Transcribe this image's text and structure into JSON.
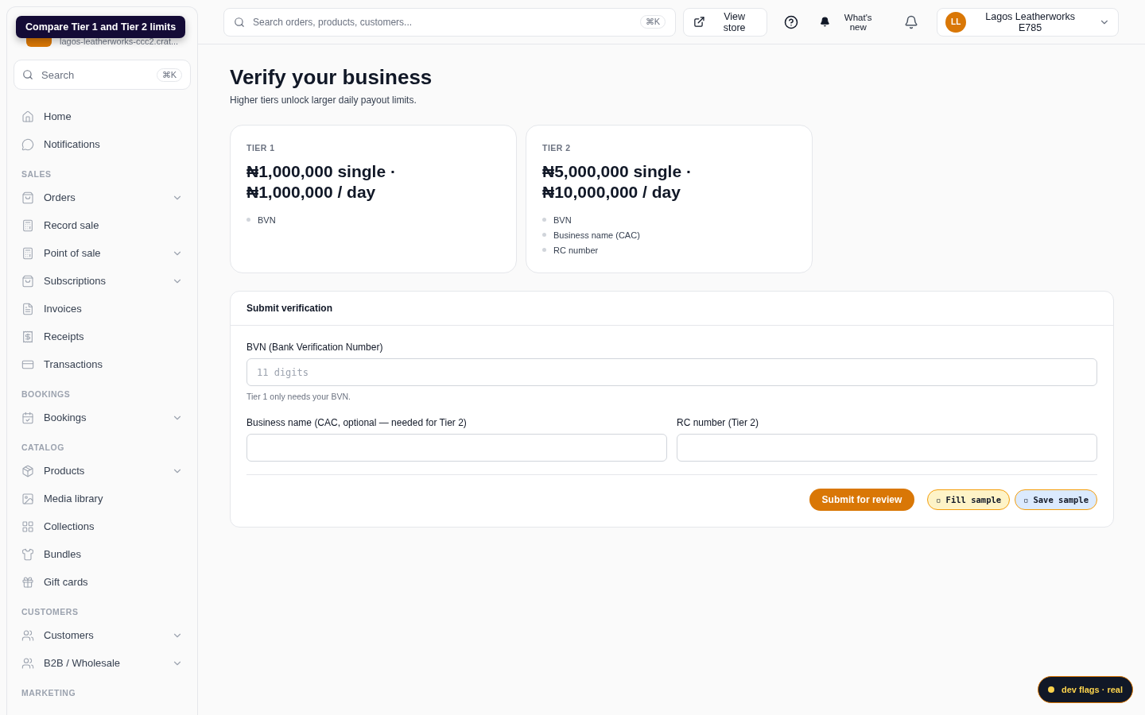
{
  "tooltip": "Compare Tier 1 and Tier 2 limits",
  "store": {
    "subtitle": "lagos-leatherworks-ccc2.crat..."
  },
  "sidebar": {
    "search": {
      "placeholder": "Search",
      "shortcut": "⌘K"
    },
    "top_items": [
      {
        "label": "Home",
        "has_submenu": false
      },
      {
        "label": "Notifications",
        "has_submenu": false
      }
    ],
    "sections": [
      {
        "title": "SALES",
        "items": [
          {
            "label": "Orders",
            "has_submenu": true
          },
          {
            "label": "Record sale",
            "has_submenu": false
          },
          {
            "label": "Point of sale",
            "has_submenu": true
          },
          {
            "label": "Subscriptions",
            "has_submenu": true
          },
          {
            "label": "Invoices",
            "has_submenu": false
          },
          {
            "label": "Receipts",
            "has_submenu": false
          },
          {
            "label": "Transactions",
            "has_submenu": false
          }
        ]
      },
      {
        "title": "BOOKINGS",
        "items": [
          {
            "label": "Bookings",
            "has_submenu": true
          }
        ]
      },
      {
        "title": "CATALOG",
        "items": [
          {
            "label": "Products",
            "has_submenu": true
          },
          {
            "label": "Media library",
            "has_submenu": false
          },
          {
            "label": "Collections",
            "has_submenu": false
          },
          {
            "label": "Bundles",
            "has_submenu": false
          },
          {
            "label": "Gift cards",
            "has_submenu": false
          }
        ]
      },
      {
        "title": "CUSTOMERS",
        "items": [
          {
            "label": "Customers",
            "has_submenu": true
          },
          {
            "label": "B2B / Wholesale",
            "has_submenu": true
          }
        ]
      },
      {
        "title": "MARKETING"
      }
    ]
  },
  "topbar": {
    "search": {
      "placeholder": "Search orders, products, customers...",
      "shortcut": "⌘K"
    },
    "view_store": "View store",
    "whats_new": "What's new",
    "account": {
      "initials": "LL",
      "name": "Lagos Leatherworks E785"
    }
  },
  "page": {
    "title": "Verify your business",
    "subtitle": "Higher tiers unlock larger daily payout limits.",
    "tiers": [
      {
        "label": "TIER 1",
        "limits": "₦1,000,000 single · ₦1,000,000 / day",
        "requirements": [
          "BVN"
        ]
      },
      {
        "label": "TIER 2",
        "limits": "₦5,000,000 single · ₦10,000,000 / day",
        "requirements": [
          "BVN",
          "Business name (CAC)",
          "RC number"
        ]
      }
    ],
    "form": {
      "title": "Submit verification",
      "bvn": {
        "label": "BVN (Bank Verification Number)",
        "placeholder": "11 digits",
        "hint": "Tier 1 only needs your BVN."
      },
      "business_name": {
        "label": "Business name (CAC, optional — needed for Tier 2)"
      },
      "rc_number": {
        "label": "RC number (Tier 2)"
      },
      "submit": "Submit for review",
      "dev_buttons": [
        {
          "icon": "▫",
          "label": "Fill sample",
          "color": "#fef3c7"
        },
        {
          "icon": "▫",
          "label": "Save sample",
          "color": "#dbeafe"
        }
      ]
    }
  },
  "dev_flags": {
    "label": "dev flags · real",
    "color": "#fcd34d"
  }
}
